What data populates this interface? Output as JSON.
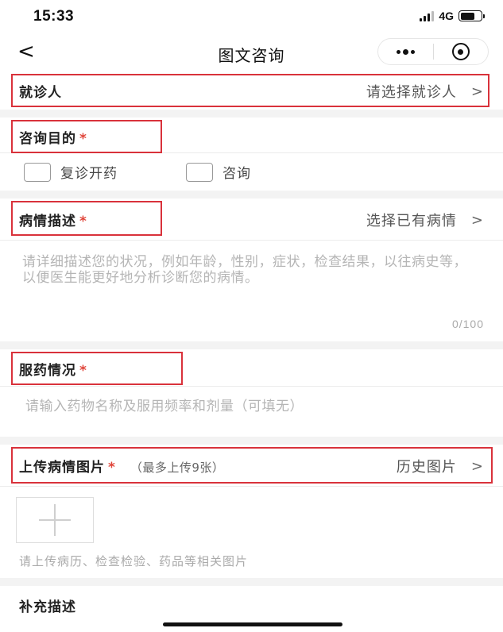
{
  "status": {
    "time": "15:33",
    "network": "4G"
  },
  "nav": {
    "back": "<",
    "title": "图文咨询"
  },
  "patient": {
    "label": "就诊人",
    "placeholder": "请选择就诊人",
    "chevron": ">"
  },
  "purpose": {
    "label": "咨询目的",
    "required_mark": "*",
    "options": [
      {
        "label": "复诊开药",
        "checked": false
      },
      {
        "label": "咨询",
        "checked": false
      }
    ]
  },
  "condition": {
    "label": "病情描述",
    "required_mark": "*",
    "action": "选择已有病情",
    "chevron": ">",
    "placeholder": "请详细描述您的状况，例如年龄，性别，症状，检查结果，以往病史等，以便医生能更好地分析诊断您的病情。",
    "counter": "0/100"
  },
  "medication": {
    "label": "服药情况",
    "required_mark": "*",
    "placeholder": "请输入药物名称及服用频率和剂量（可填无）"
  },
  "upload": {
    "label": "上传病情图片",
    "required_mark": "*",
    "note": "（最多上传9张）",
    "action": "历史图片",
    "chevron": ">",
    "hint": "请上传病历、检查检验、药品等相关图片"
  },
  "supplement": {
    "label": "补充描述"
  },
  "colors": {
    "highlight": "#d9323b",
    "required": "#e0453a",
    "placeholder": "#b5b5b5"
  }
}
